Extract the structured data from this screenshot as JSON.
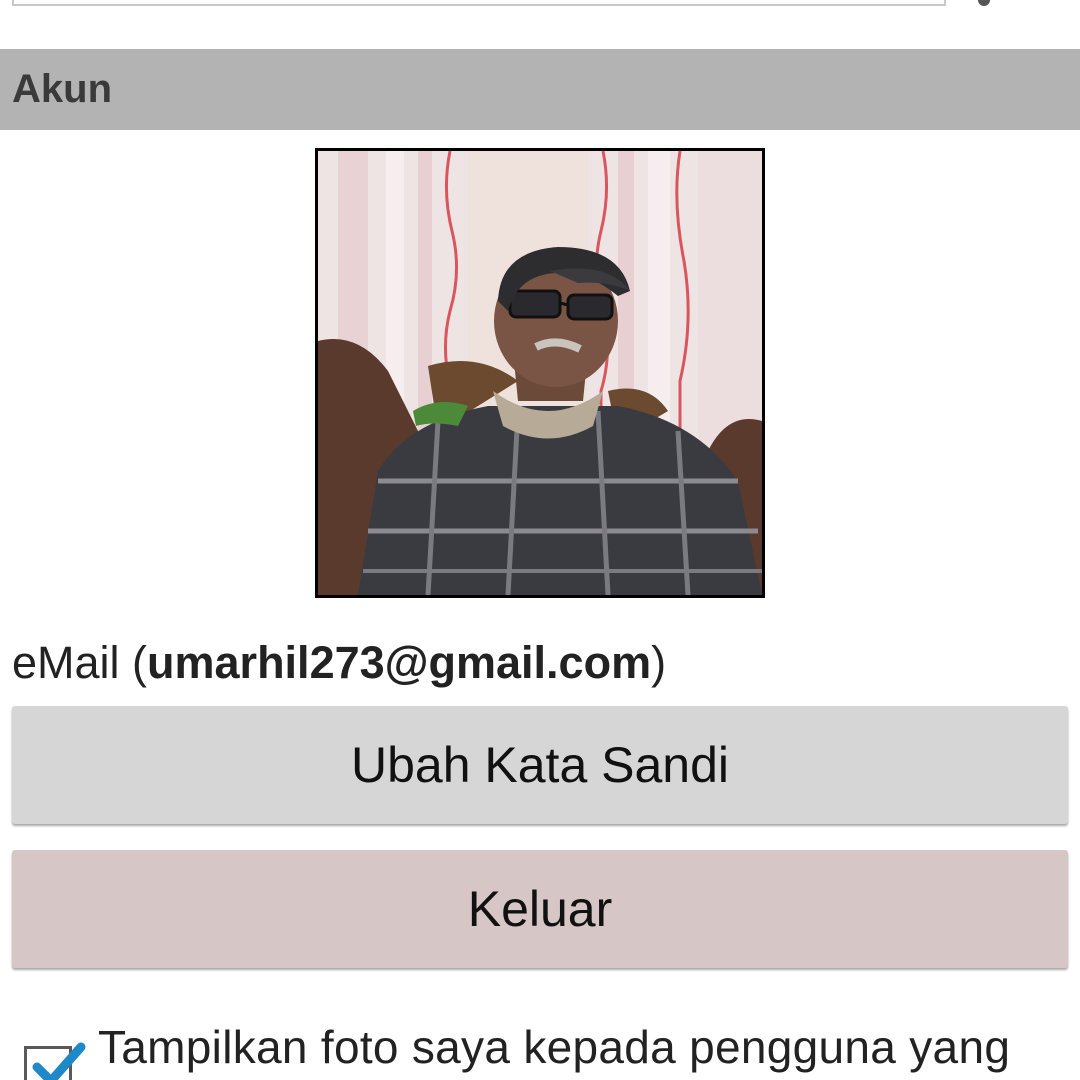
{
  "account_section": {
    "title": "Akun"
  },
  "profile": {
    "photo_alt": "profile-photo"
  },
  "email": {
    "prefix": "eMail (",
    "address": "umarhil273@gmail.com",
    "suffix": ")"
  },
  "buttons": {
    "change_password": "Ubah Kata Sandi",
    "logout": "Keluar"
  },
  "options": {
    "show_photo_label": "Tampilkan foto saya kepada pengguna yang",
    "show_photo_checked": true
  },
  "colors": {
    "section_header_bg": "#b3b3b3",
    "change_password_bg": "#d6d6d6",
    "logout_bg": "#d7c6c6",
    "checkmark": "#1e88c8"
  },
  "icons": {
    "checkbox": "checkmark-icon"
  }
}
